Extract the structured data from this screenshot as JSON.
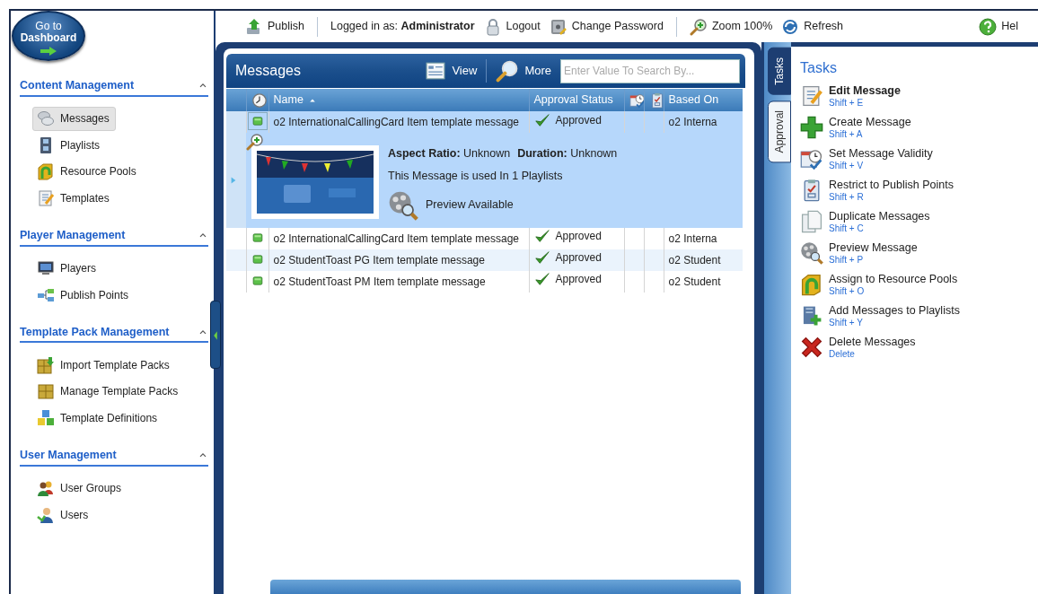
{
  "dashboard_button": {
    "label": "Go to **Dashboard**"
  },
  "toolbar": {
    "groups": [
      [
        {
          "kind": "publish",
          "label": "Publish"
        }
      ],
      [
        {
          "kind": "user",
          "label": "Logged in as: **Administrator**"
        },
        {
          "kind": "logout",
          "label": "Logout"
        },
        {
          "kind": "change_password",
          "label": "Change Password"
        }
      ],
      [
        {
          "kind": "zoom",
          "label": "Zoom 100%"
        },
        {
          "kind": "refresh",
          "label": "Refresh"
        }
      ]
    ],
    "help": {
      "kind": "help",
      "label": "Hel"
    }
  },
  "sidebar": {
    "sections": [
      {
        "title": "Content Management",
        "expanded": true,
        "items": [
          {
            "kind": "messages",
            "label": "Messages",
            "selected": true
          },
          {
            "kind": "playlists",
            "label": "Playlists",
            "selected": false
          },
          {
            "kind": "folder",
            "label": "Resource Pools",
            "selected": false
          },
          {
            "kind": "templates",
            "label": "Templates",
            "selected": false
          }
        ]
      },
      {
        "title": "Player Management",
        "expanded": true,
        "items": [
          {
            "kind": "players",
            "label": "Players",
            "selected": false
          },
          {
            "kind": "publish_points",
            "label": "Publish Points",
            "selected": false
          }
        ]
      },
      {
        "title": "Template Pack Management",
        "expanded": true,
        "items": [
          {
            "kind": "import",
            "label": "Import Template Packs",
            "selected": false
          },
          {
            "kind": "crate",
            "label": "Manage Template Packs",
            "selected": false
          },
          {
            "kind": "definitions",
            "label": "Template Definitions",
            "selected": false
          }
        ]
      },
      {
        "title": "User Management",
        "expanded": true,
        "items": [
          {
            "kind": "user_groups",
            "label": "User Groups",
            "selected": false
          },
          {
            "kind": "users",
            "label": "Users",
            "selected": false
          }
        ]
      }
    ]
  },
  "messages_panel": {
    "title": "Messages",
    "view_label": "View",
    "more_label": "More",
    "search": {
      "placeholder": "Enter Value To Search By..."
    },
    "columns": [
      {
        "kind": "clock"
      },
      {
        "kind": "text",
        "label": "Name",
        "sorted": true
      },
      {
        "kind": "text",
        "label": "Approval Status"
      },
      {
        "kind": "validity"
      },
      {
        "kind": "restrict"
      },
      {
        "kind": "text",
        "label": "Based On"
      }
    ],
    "rows": [
      {
        "name": "o2 InternationalCallingCard Item template message",
        "approval": "Approved",
        "based_on": "o2 Interna",
        "selected": true,
        "detail": {
          "aspect_ratio": "**Aspect Ratio:** Unknown",
          "duration": "**Duration:** Unknown",
          "usage": "This Message is used In 1 Playlists",
          "preview": "Preview Available"
        }
      },
      {
        "name": "o2 InternationalCallingCard Item template message",
        "approval": "Approved",
        "based_on": "o2 Interna",
        "selected": false
      },
      {
        "name": "o2 StudentToast PG Item template message",
        "approval": "Approved",
        "based_on": "o2 Student",
        "selected": false
      },
      {
        "name": "o2 StudentToast PM Item template message",
        "approval": "Approved",
        "based_on": "o2 Student",
        "selected": false
      }
    ]
  },
  "side_tabs": [
    {
      "label": "Tasks",
      "selected": true
    },
    {
      "label": "Approval",
      "selected": false
    }
  ],
  "tasks": {
    "title": "Tasks",
    "items": [
      {
        "kind": "edit",
        "label": "Edit Message",
        "shortcut": "Shift + E",
        "default": true
      },
      {
        "kind": "create",
        "label": "Create Message",
        "shortcut": "Shift + A",
        "default": false
      },
      {
        "kind": "validity",
        "label": "Set Message Validity",
        "shortcut": "Shift + V",
        "default": false
      },
      {
        "kind": "restrict",
        "label": "Restrict to Publish Points",
        "shortcut": "Shift + R",
        "default": false
      },
      {
        "kind": "duplicate",
        "label": "Duplicate Messages",
        "shortcut": "Shift + C",
        "default": false
      },
      {
        "kind": "preview",
        "label": "Preview Message",
        "shortcut": "Shift + P",
        "default": false
      },
      {
        "kind": "folder",
        "label": "Assign to Resource Pools",
        "shortcut": "Shift + O",
        "default": false
      },
      {
        "kind": "add_to_playlist",
        "label": "Add Messages to Playlists",
        "shortcut": "Shift + Y",
        "default": false
      },
      {
        "kind": "delete",
        "label": "Delete Messages",
        "shortcut": "Delete",
        "default": false
      }
    ]
  }
}
